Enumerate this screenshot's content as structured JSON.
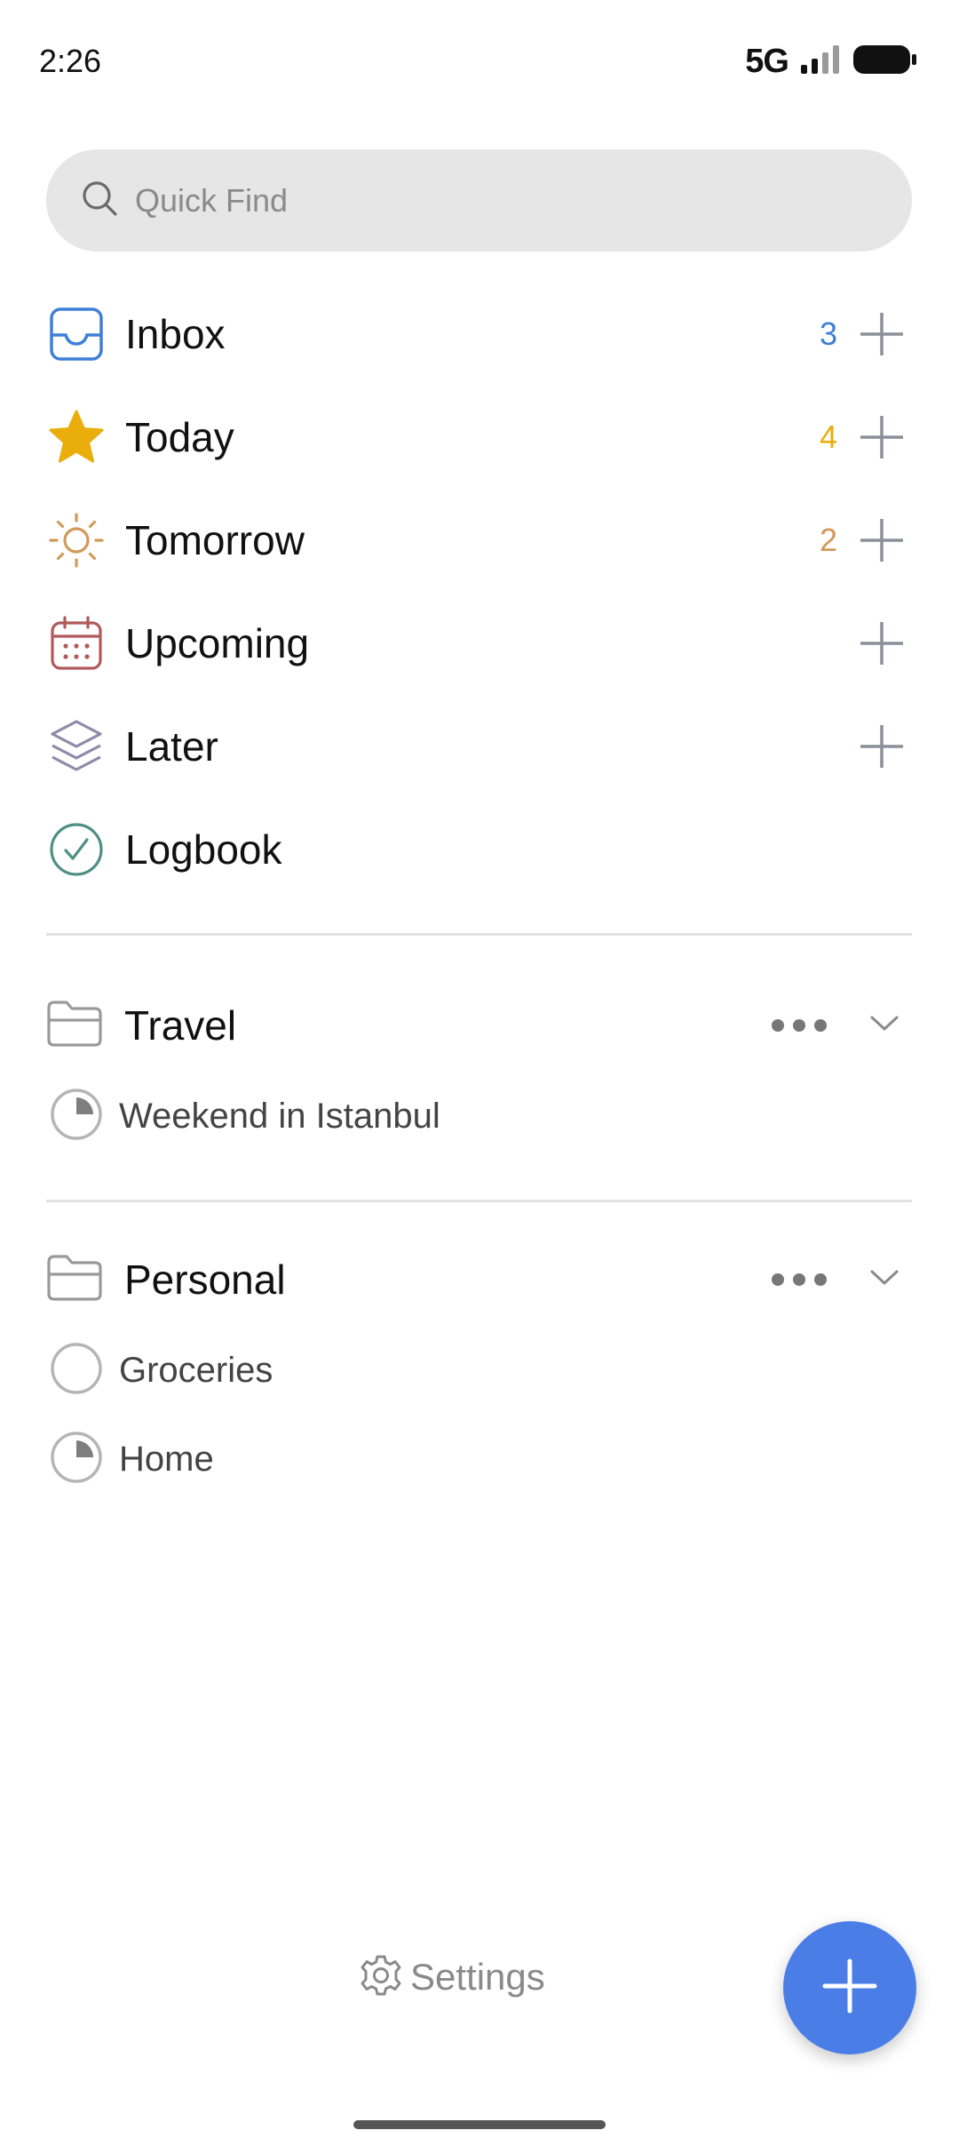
{
  "status_bar": {
    "time": "2:26",
    "network": "5G",
    "battery": "battery-icon",
    "signal": "signal-icon"
  },
  "search": {
    "placeholder": "Quick Find",
    "icon": "search-icon"
  },
  "nav": [
    {
      "label": "Inbox",
      "count": "3",
      "icon": "inbox-icon",
      "color": "#3f7fd6"
    },
    {
      "label": "Today",
      "count": "4",
      "icon": "star-icon",
      "color": "#e9ae0b"
    },
    {
      "label": "Tomorrow",
      "count": "2",
      "icon": "sun-icon",
      "color": "#d29a5a"
    },
    {
      "label": "Upcoming",
      "count": "",
      "icon": "calendar-icon",
      "color": "#b05a5a"
    },
    {
      "label": "Later",
      "count": "",
      "icon": "layers-icon",
      "color": "#8f8aa8"
    },
    {
      "label": "Logbook",
      "count": "",
      "icon": "check-circle-icon",
      "color": "#4f8f85"
    }
  ],
  "areas": [
    {
      "label": "Travel",
      "projects": [
        {
          "label": "Weekend in Istanbul",
          "progress": 0.25
        }
      ]
    },
    {
      "label": "Personal",
      "projects": [
        {
          "label": "Groceries",
          "progress": 0
        },
        {
          "label": "Home",
          "progress": 0.25
        }
      ]
    }
  ],
  "footer": {
    "settings_label": "Settings"
  },
  "colors": {
    "accent": "#4a7ee6",
    "add_icon": "#8a8f99",
    "divider": "#e2e2e2"
  }
}
